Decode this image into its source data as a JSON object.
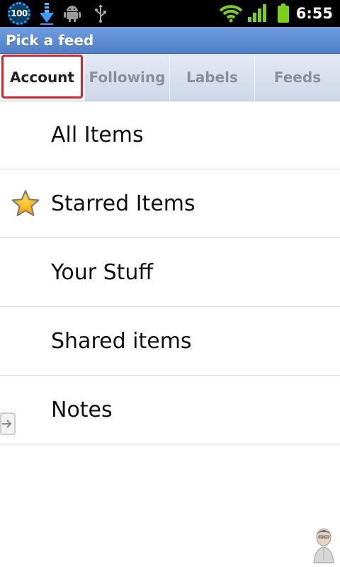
{
  "status_bar": {
    "battery_level": "100",
    "time": "6:55"
  },
  "header": {
    "title": "Pick a feed"
  },
  "tabs": [
    {
      "label": "Account",
      "active": true
    },
    {
      "label": "Following",
      "active": false
    },
    {
      "label": "Labels",
      "active": false
    },
    {
      "label": "Feeds",
      "active": false
    }
  ],
  "feeds": [
    {
      "label": "All Items",
      "icon": ""
    },
    {
      "label": "Starred Items",
      "icon": "star-icon"
    },
    {
      "label": "Your Stuff",
      "icon": ""
    },
    {
      "label": "Shared items",
      "icon": ""
    },
    {
      "label": "Notes",
      "icon": ""
    }
  ],
  "colors": {
    "title_bar": "#5b8bd2",
    "highlight": "#e0202a",
    "tab_bg": "#d4dcec"
  }
}
